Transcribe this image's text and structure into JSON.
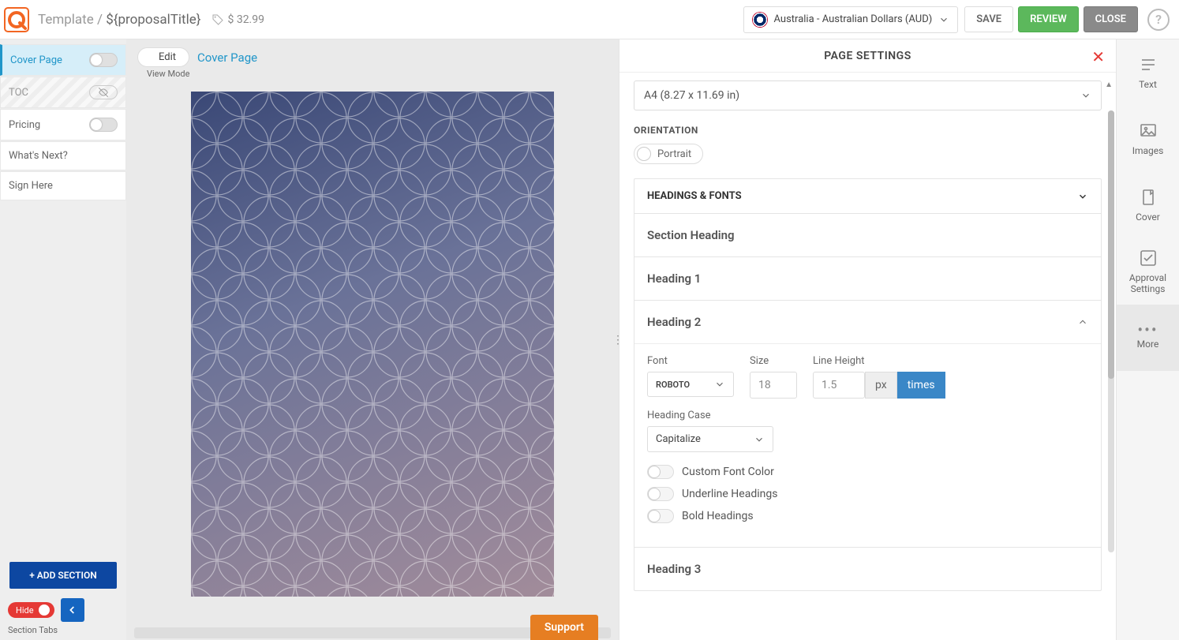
{
  "header": {
    "breadcrumb_prefix": "Template / ",
    "title": "${proposalTitle}",
    "price": "$ 32.99",
    "currency_label": "Australia - Australian Dollars (AUD)",
    "save": "SAVE",
    "review": "REVIEW",
    "close": "CLOSE",
    "help": "?"
  },
  "sections": {
    "items": [
      {
        "label": "Cover Page",
        "state": "active"
      },
      {
        "label": "TOC",
        "state": "disabled"
      },
      {
        "label": "Pricing",
        "state": "normal"
      },
      {
        "label": "What's Next?",
        "state": "normal"
      },
      {
        "label": "Sign Here",
        "state": "normal"
      }
    ],
    "add_label": "+ ADD SECTION",
    "hide_label": "Hide",
    "tabs_label": "Section Tabs"
  },
  "canvas": {
    "edit_label": "Edit",
    "view_mode": "View Mode",
    "page_link": "Cover Page",
    "support": "Support"
  },
  "panel": {
    "title": "PAGE SETTINGS",
    "paper_size": "A4 (8.27 x 11.69 in)",
    "orientation_label": "ORIENTATION",
    "orientation_value": "Portrait",
    "group_title": "HEADINGS & FONTS",
    "sub_section_heading": "Section Heading",
    "sub_h1": "Heading 1",
    "sub_h2": "Heading 2",
    "sub_h3": "Heading 3",
    "font_label": "Font",
    "font_value": "ROBOTO",
    "size_label": "Size",
    "size_value": "18",
    "lh_label": "Line Height",
    "lh_value": "1.5",
    "unit_px": "px",
    "unit_times": "times",
    "case_label": "Heading Case",
    "case_value": "Capitalize",
    "opt_custom_color": "Custom Font Color",
    "opt_underline": "Underline Headings",
    "opt_bold": "Bold Headings"
  },
  "rail": {
    "text": "Text",
    "images": "Images",
    "cover": "Cover",
    "approval": "Approval Settings",
    "more": "More"
  }
}
